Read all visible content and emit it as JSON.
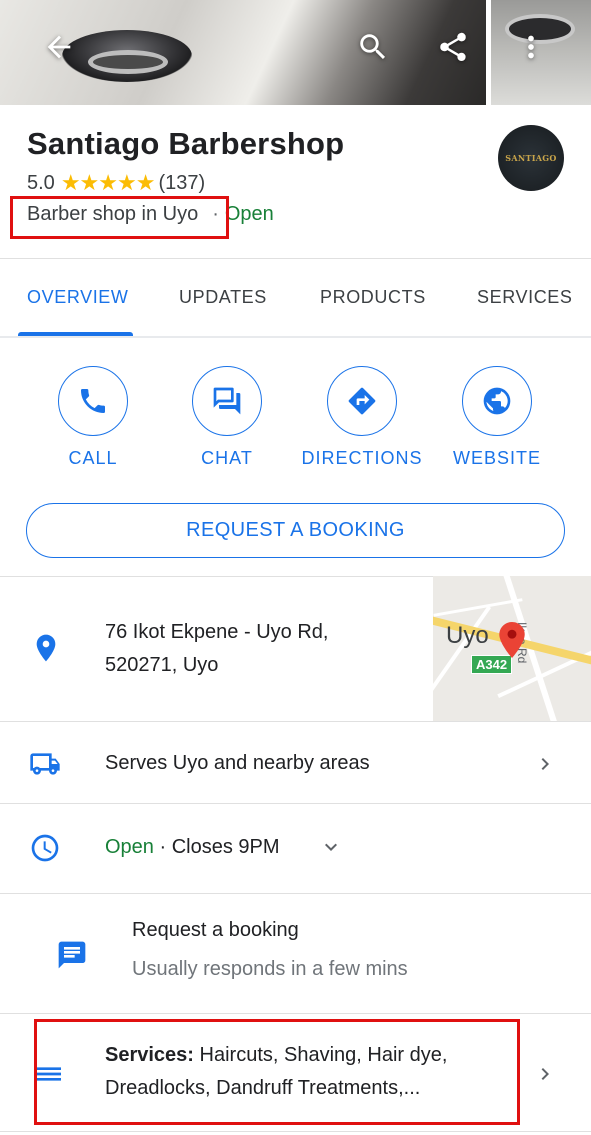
{
  "header": {
    "back_icon": "arrow-back-icon",
    "search_icon": "search-icon",
    "share_icon": "share-icon",
    "more_icon": "more-vert-icon"
  },
  "place": {
    "name": "Santiago Barbershop",
    "rating": "5.0",
    "stars": "★★★★★",
    "review_count": "(137)",
    "category": "Barber shop in Uyo",
    "separator": "·",
    "status": "Open",
    "logo_text": "SANTIAGO"
  },
  "tabs": [
    {
      "label": "OVERVIEW",
      "active": true
    },
    {
      "label": "UPDATES",
      "active": false
    },
    {
      "label": "PRODUCTS",
      "active": false
    },
    {
      "label": "SERVICES",
      "active": false
    }
  ],
  "actions": [
    {
      "label": "CALL",
      "icon": "phone-icon"
    },
    {
      "label": "CHAT",
      "icon": "chat-icon"
    },
    {
      "label": "DIRECTIONS",
      "icon": "directions-icon"
    },
    {
      "label": "WEBSITE",
      "icon": "globe-icon"
    }
  ],
  "booking_button": "REQUEST A BOOKING",
  "address": {
    "line1": "76 Ikot Ekpene - Uyo Rd,",
    "line2": "520271, Uyo",
    "icon": "location-pin-icon"
  },
  "map": {
    "city_label": "Uyo",
    "road_shield": "A342",
    "road_name": "Ikpa Rd"
  },
  "service_area": {
    "text": "Serves Uyo and nearby areas",
    "icon": "delivery-truck-icon"
  },
  "hours": {
    "status": "Open",
    "separator": " · ",
    "closes": "Closes 9PM",
    "icon": "clock-icon"
  },
  "booking_info": {
    "title": "Request a booking",
    "subtitle": "Usually responds in a few mins",
    "icon": "message-icon"
  },
  "services": {
    "label": "Services:",
    "line1": " Haircuts, Shaving, Hair dye,",
    "line2": "Dreadlocks, Dandruff Treatments,...",
    "icon": "list-icon"
  },
  "colors": {
    "accent": "#1a73e8",
    "open_green": "#188038",
    "star_yellow": "#fbbc04",
    "highlight_red": "#e01010"
  }
}
